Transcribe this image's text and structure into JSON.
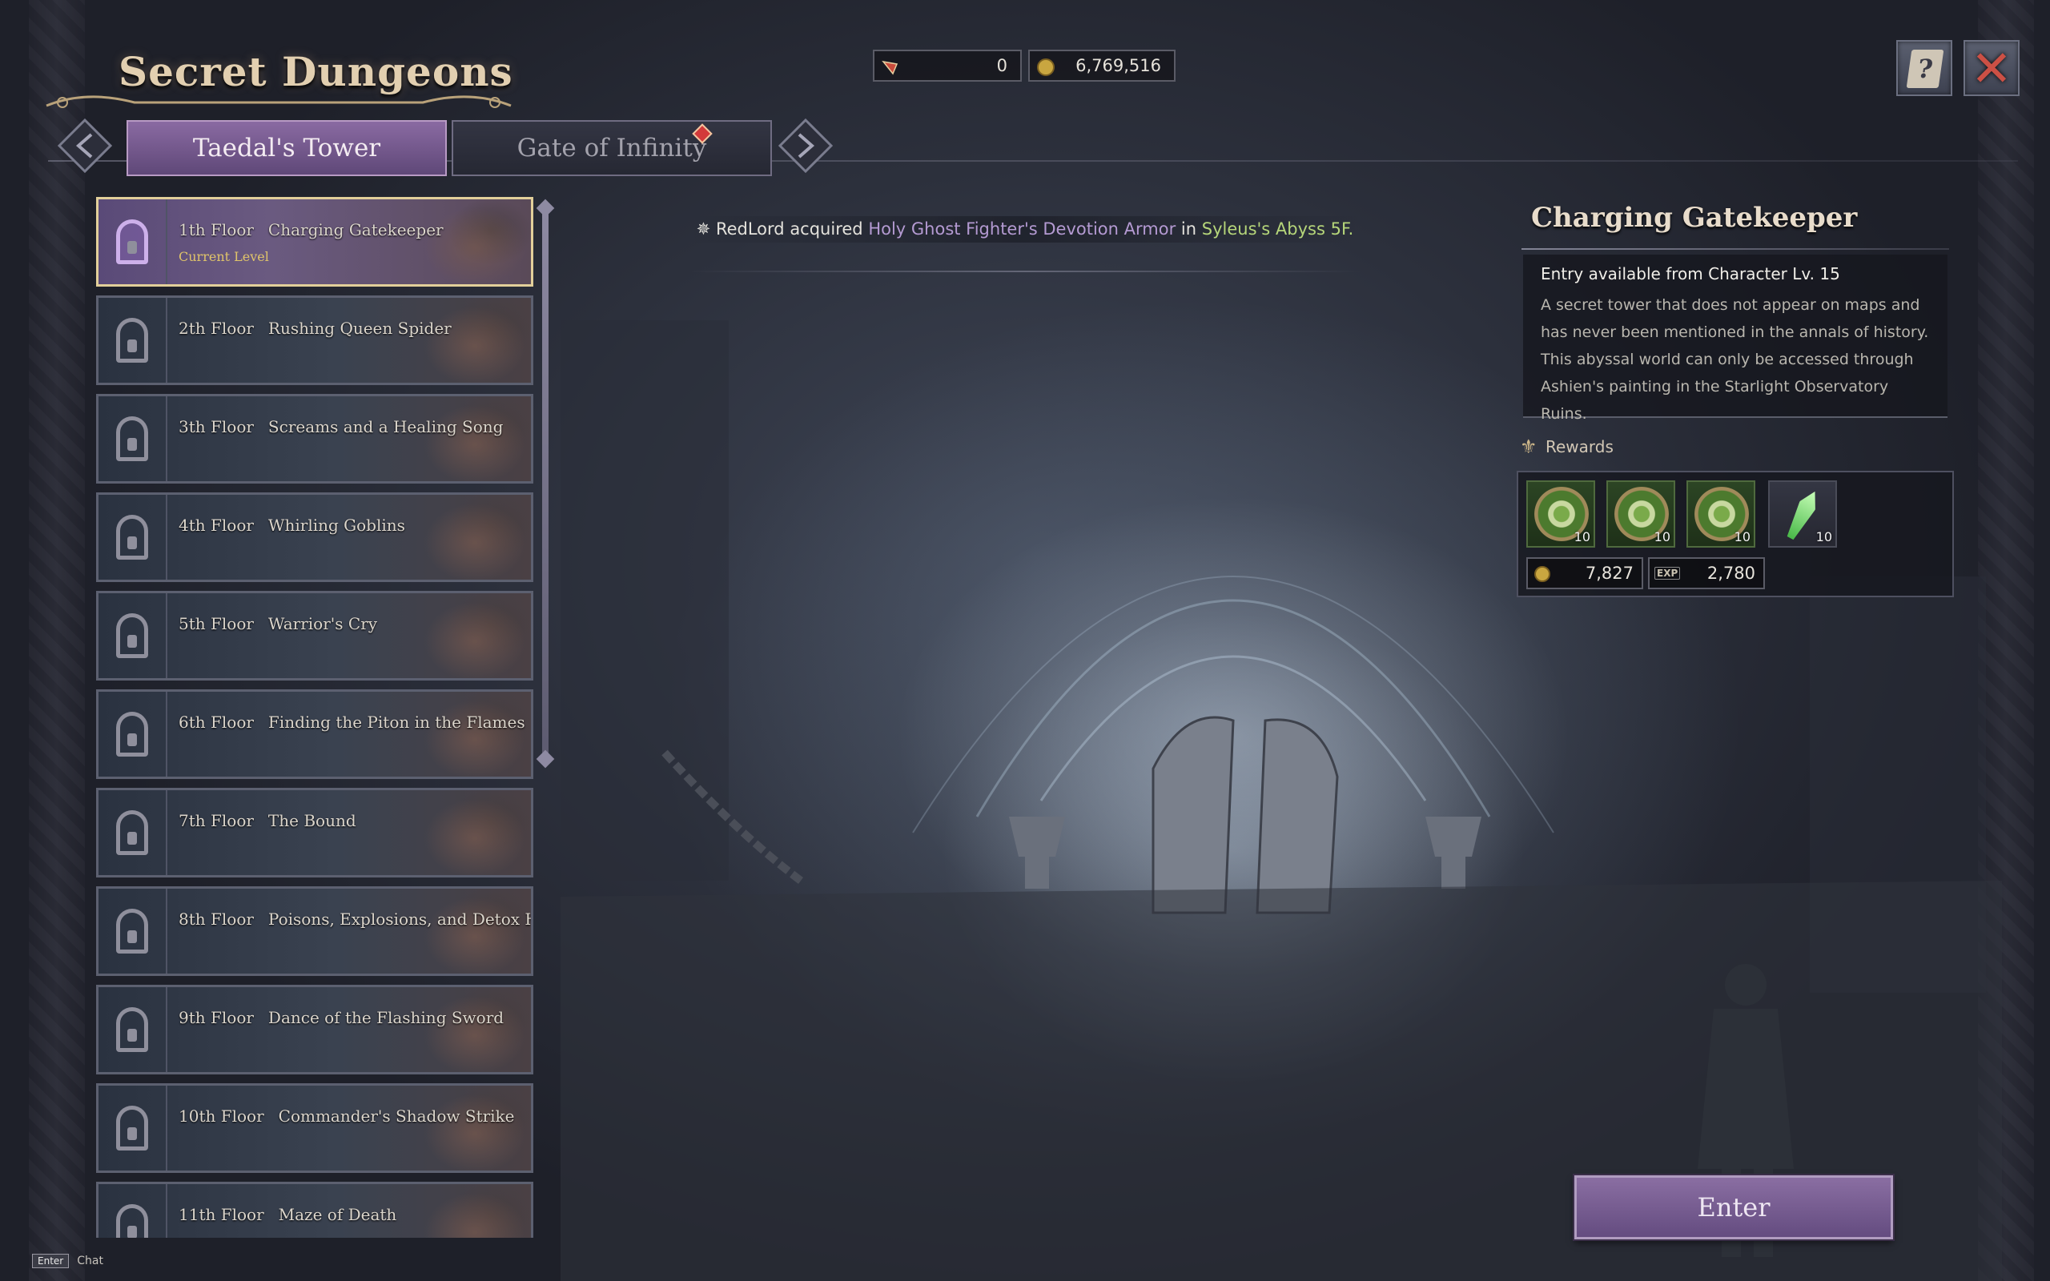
{
  "header": {
    "title": "Secret Dungeons"
  },
  "currency": {
    "tickets": "0",
    "gold": "6,769,516"
  },
  "tabs": [
    {
      "label": "Taedal's Tower",
      "active": true
    },
    {
      "label": "Gate of Infinity",
      "active": false,
      "badge": true
    }
  ],
  "floors": [
    {
      "floor": "1th Floor",
      "name": "Charging Gatekeeper",
      "status": "Current Level",
      "locked": false
    },
    {
      "floor": "2th Floor",
      "name": "Rushing Queen Spider",
      "locked": true
    },
    {
      "floor": "3th Floor",
      "name": "Screams and a Healing Song",
      "locked": true
    },
    {
      "floor": "4th Floor",
      "name": "Whirling Goblins",
      "locked": true
    },
    {
      "floor": "5th Floor",
      "name": "Warrior's Cry",
      "locked": true
    },
    {
      "floor": "6th Floor",
      "name": "Finding the Piton in the Flames",
      "locked": true
    },
    {
      "floor": "7th Floor",
      "name": "The Bound",
      "locked": true
    },
    {
      "floor": "8th Floor",
      "name": "Poisons, Explosions, and Detox Herb",
      "locked": true
    },
    {
      "floor": "9th Floor",
      "name": "Dance of the Flashing Sword",
      "locked": true
    },
    {
      "floor": "10th Floor",
      "name": "Commander's Shadow Strike",
      "locked": true
    },
    {
      "floor": "11th Floor",
      "name": "Maze of Death",
      "locked": true
    }
  ],
  "notification": {
    "player": "RedLord",
    "verb": "acquired",
    "item": "Holy Ghost Fighter's Devotion Armor",
    "preposition": "in",
    "place": "Syleus's Abyss 5F."
  },
  "detail": {
    "title": "Charging Gatekeeper",
    "requirement": "Entry available from Character Lv. 15",
    "description": "A secret tower that does not appear on maps and has never been mentioned in the annals of history. This abyssal world can only be accessed through Ashien's painting in the Starlight Observatory Ruins.",
    "rewards_label": "Rewards",
    "rewards": [
      {
        "icon": "crossed-weapons-ring-icon",
        "qty": "10"
      },
      {
        "icon": "armor-ring-icon",
        "qty": "10"
      },
      {
        "icon": "ring-icon",
        "qty": "10"
      },
      {
        "icon": "green-crystal-icon",
        "qty": "10"
      }
    ],
    "gold_reward": "7,827",
    "exp_reward": "2,780",
    "exp_tag": "EXP"
  },
  "enter_label": "Enter",
  "chat": {
    "key": "Enter",
    "label": "Chat"
  },
  "icons": {
    "help": "help-book-icon",
    "close": "close-icon",
    "ticket": "ticket-icon",
    "gold": "gold-coin-icon"
  },
  "colors": {
    "accent_purple": "#6f5690",
    "gold_border": "#e2cf9a",
    "item_highlight": "#b49ad2",
    "place_highlight": "#b6d67a",
    "close_red": "#cc5045"
  }
}
